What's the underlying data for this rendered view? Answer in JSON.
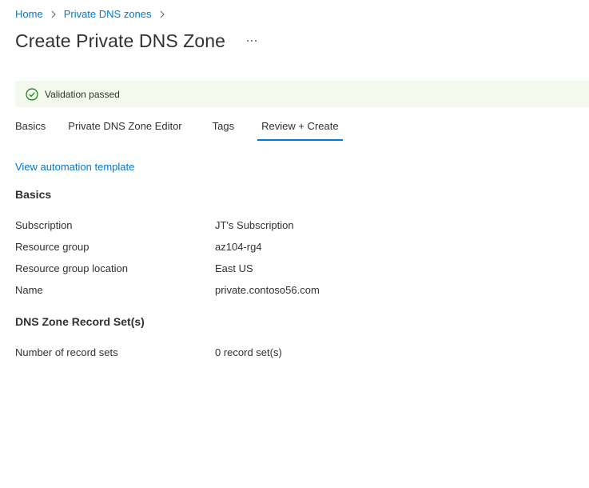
{
  "breadcrumb": {
    "items": [
      "Home",
      "Private DNS zones"
    ]
  },
  "header": {
    "title": "Create Private DNS Zone",
    "more_label": "..."
  },
  "validation": {
    "text": "Validation passed",
    "status_color": "#107c10"
  },
  "tabs": [
    {
      "label": "Basics",
      "active": false
    },
    {
      "label": "Private DNS Zone Editor",
      "active": false
    },
    {
      "label": "Tags",
      "active": false
    },
    {
      "label": "Review + Create",
      "active": true
    }
  ],
  "links": {
    "automation": "View automation template"
  },
  "sections": {
    "basics": {
      "heading": "Basics",
      "rows": [
        {
          "label": "Subscription",
          "value": "JT's Subscription"
        },
        {
          "label": "Resource group",
          "value": "az104-rg4"
        },
        {
          "label": "Resource group location",
          "value": "East US"
        },
        {
          "label": "Name",
          "value": "private.contoso56.com"
        }
      ]
    },
    "dns": {
      "heading": "DNS Zone Record Set(s)",
      "rows": [
        {
          "label": "Number of record sets",
          "value": "0 record set(s)"
        }
      ]
    }
  },
  "colors": {
    "accent": "#0078d4",
    "validation_bg": "#f3f9ec"
  },
  "icons": {
    "breadcrumb_separator": "chevron-right-icon",
    "validation": "check-circle-icon",
    "more": "more-horizontal-icon"
  }
}
